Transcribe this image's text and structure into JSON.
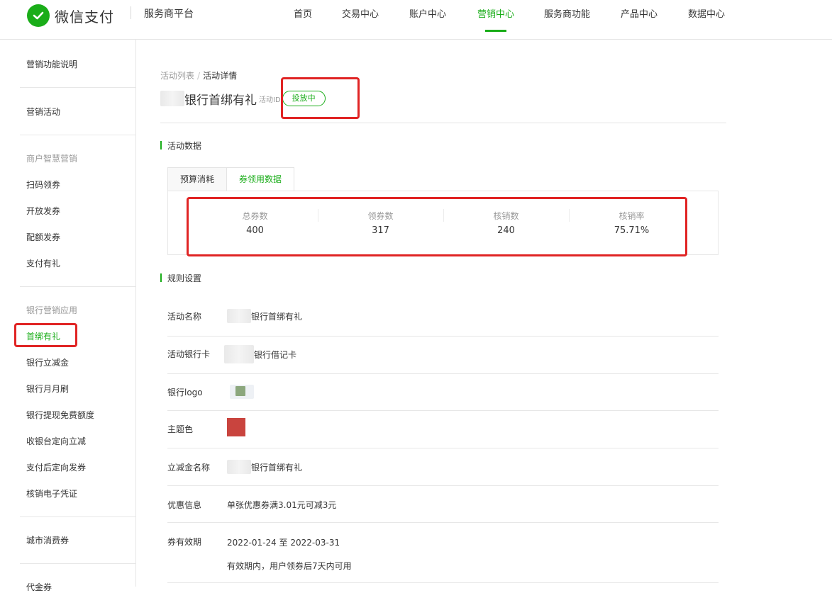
{
  "header": {
    "brand": "微信支付",
    "platform": "服务商平台",
    "nav": [
      {
        "label": "首页"
      },
      {
        "label": "交易中心"
      },
      {
        "label": "账户中心"
      },
      {
        "label": "营销中心"
      },
      {
        "label": "服务商功能"
      },
      {
        "label": "产品中心"
      },
      {
        "label": "数据中心"
      }
    ],
    "active_nav": "营销中心"
  },
  "sidebar": {
    "items": [
      {
        "label": "营销功能说明",
        "type": "item"
      },
      {
        "label": "营销活动",
        "type": "item"
      },
      {
        "label": "商户智慧营销",
        "type": "group"
      },
      {
        "label": "扫码领券",
        "type": "item"
      },
      {
        "label": "开放发券",
        "type": "item"
      },
      {
        "label": "配额发券",
        "type": "item"
      },
      {
        "label": "支付有礼",
        "type": "item"
      },
      {
        "label": "银行营销应用",
        "type": "group"
      },
      {
        "label": "首绑有礼",
        "type": "item",
        "active": true
      },
      {
        "label": "银行立减金",
        "type": "item"
      },
      {
        "label": "银行月月刷",
        "type": "item"
      },
      {
        "label": "银行提现免费额度",
        "type": "item"
      },
      {
        "label": "收银台定向立减",
        "type": "item"
      },
      {
        "label": "支付后定向发券",
        "type": "item"
      },
      {
        "label": "核销电子凭证",
        "type": "item"
      },
      {
        "label": "城市消费券",
        "type": "item"
      },
      {
        "label": "代金券",
        "type": "item"
      }
    ]
  },
  "breadcrumb": {
    "parent": "活动列表",
    "separator": "/",
    "current": "活动详情"
  },
  "activity": {
    "title": "银行首绑有礼",
    "id_label": "活动ID",
    "status": "投放中"
  },
  "data_section": {
    "title": "活动数据",
    "tabs": [
      {
        "label": "预算消耗"
      },
      {
        "label": "券领用数据"
      }
    ],
    "active_tab": "券领用数据",
    "stats": [
      {
        "label": "总券数",
        "value": "400"
      },
      {
        "label": "领券数",
        "value": "317"
      },
      {
        "label": "核销数",
        "value": "240"
      },
      {
        "label": "核销率",
        "value": "75.71%"
      }
    ]
  },
  "rules_section": {
    "title": "规则设置",
    "rows": {
      "name": {
        "label": "活动名称",
        "value": "银行首绑有礼"
      },
      "card": {
        "label": "活动银行卡",
        "value": "银行借记卡"
      },
      "logo": {
        "label": "银行logo"
      },
      "theme": {
        "label": "主题色",
        "color": "#c9443e"
      },
      "coupon_name": {
        "label": "立减金名称",
        "value": "银行首绑有礼"
      },
      "discount": {
        "label": "优惠信息",
        "value": "单张优惠券满3.01元可减3元"
      },
      "validity": {
        "label": "券有效期",
        "value": "2022-01-24 至 2022-03-31",
        "note": "有效期内，用户领券后7天内可用"
      }
    }
  },
  "colors": {
    "brand_green": "#1aad19",
    "highlight_red": "#e02424"
  }
}
